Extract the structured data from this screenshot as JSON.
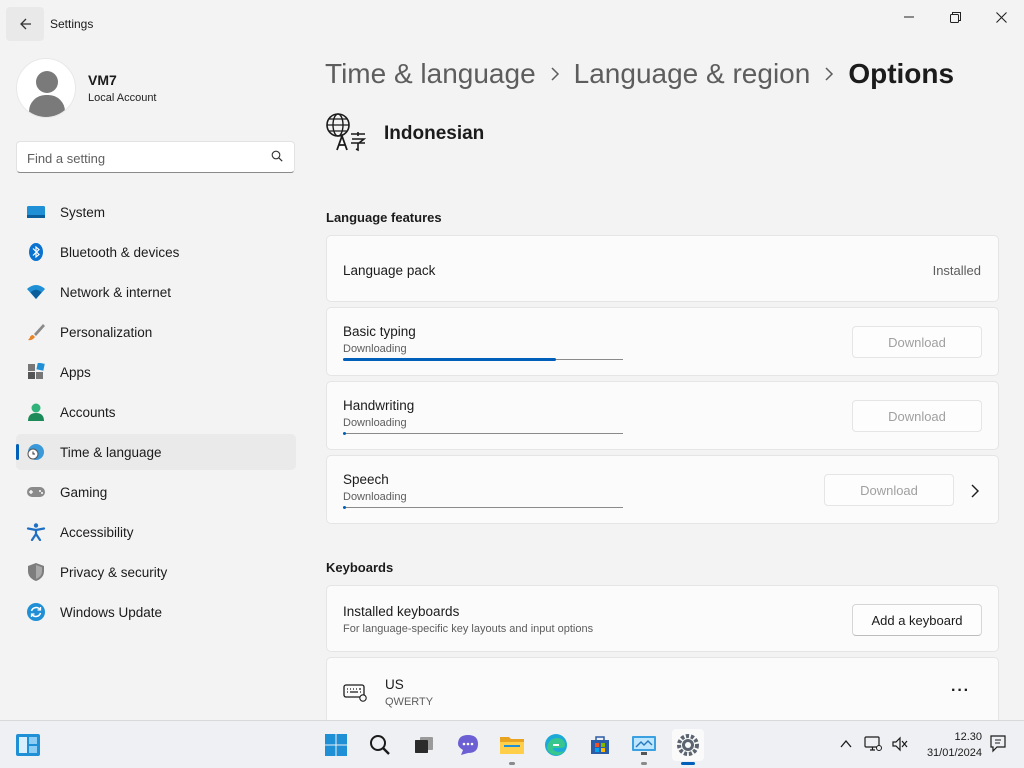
{
  "window": {
    "title": "Settings",
    "back_icon": "arrow-left-icon",
    "controls": [
      "minimize-icon",
      "maximize-icon",
      "close-icon"
    ]
  },
  "profile": {
    "name": "VM7",
    "account_type": "Local Account"
  },
  "search": {
    "placeholder": "Find a setting",
    "icon": "search-icon"
  },
  "sidebar": {
    "items": [
      {
        "label": "System",
        "icon": "system-monitor-icon",
        "active": false
      },
      {
        "label": "Bluetooth & devices",
        "icon": "bluetooth-icon",
        "active": false
      },
      {
        "label": "Network & internet",
        "icon": "wifi-icon",
        "active": false
      },
      {
        "label": "Personalization",
        "icon": "paintbrush-icon",
        "active": false
      },
      {
        "label": "Apps",
        "icon": "apps-icon",
        "active": false
      },
      {
        "label": "Accounts",
        "icon": "accounts-icon",
        "active": false
      },
      {
        "label": "Time & language",
        "icon": "globe-clock-icon",
        "active": true
      },
      {
        "label": "Gaming",
        "icon": "gamepad-icon",
        "active": false
      },
      {
        "label": "Accessibility",
        "icon": "accessibility-icon",
        "active": false
      },
      {
        "label": "Privacy & security",
        "icon": "shield-icon",
        "active": false
      },
      {
        "label": "Windows Update",
        "icon": "windows-update-icon",
        "active": false
      }
    ]
  },
  "breadcrumb": {
    "items": [
      "Time & language",
      "Language & region"
    ],
    "current": "Options",
    "separator_icon": "chevron-right-icon"
  },
  "language": {
    "name": "Indonesian",
    "icon": "language-icon"
  },
  "language_features": {
    "title": "Language features",
    "pack": {
      "label": "Language pack",
      "status": "Installed"
    },
    "basic_typing": {
      "label": "Basic typing",
      "status": "Downloading",
      "progress": 0.76,
      "button": "Download"
    },
    "handwriting": {
      "label": "Handwriting",
      "status": "Downloading",
      "progress": 0.01,
      "button": "Download"
    },
    "speech": {
      "label": "Speech",
      "status": "Downloading",
      "progress": 0.01,
      "button": "Download"
    }
  },
  "keyboards": {
    "title": "Keyboards",
    "installed": {
      "label": "Installed keyboards",
      "description": "For language-specific key layouts and input options",
      "button": "Add a keyboard"
    },
    "items": [
      {
        "name": "US",
        "layout": "QWERTY",
        "icon": "keyboard-icon",
        "more_icon": "more-options-icon"
      }
    ]
  },
  "taskbar": {
    "apps": [
      "start-icon",
      "search-icon",
      "task-view-icon",
      "chat-icon",
      "file-explorer-icon",
      "edge-icon",
      "store-icon",
      "remote-desktop-icon",
      "settings-icon"
    ],
    "active_app": "settings-icon",
    "tray": [
      "chevron-up-icon",
      "network-icon",
      "volume-muted-icon",
      "notification-icon"
    ],
    "time": "12.30",
    "date": "31/01/2024"
  },
  "colors": {
    "accent": "#005fb8",
    "background": "#f3f3f3",
    "card": "#fbfbfb"
  }
}
